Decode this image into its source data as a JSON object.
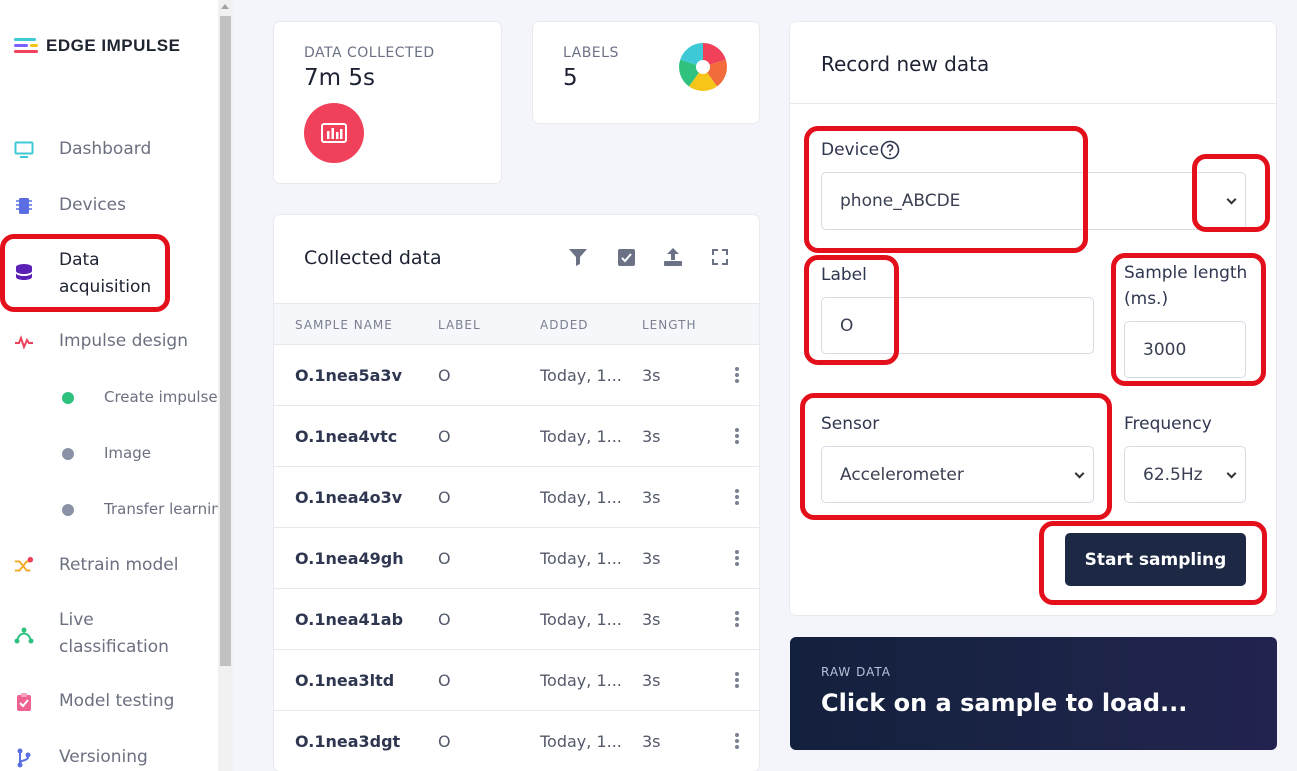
{
  "brand": {
    "name": "EDGE IMPULSE",
    "logo_colors": [
      "#3ec9d6",
      "#f5c518",
      "#f0405a",
      "#7b61ff"
    ]
  },
  "sidebar": {
    "items": [
      {
        "label": "Dashboard",
        "icon": "monitor-icon",
        "color": "#3ec9d6"
      },
      {
        "label": "Devices",
        "icon": "chip-icon",
        "color": "#5b6ee1"
      },
      {
        "label": "Data\nacquisition",
        "icon": "database-icon",
        "color": "#5b21b6"
      },
      {
        "label": "Impulse design",
        "icon": "pulse-icon",
        "color": "#f0405a"
      },
      {
        "label": "Retrain model",
        "icon": "shuffle-icon",
        "color": "#f5a623"
      },
      {
        "label": "Live\nclassification",
        "icon": "network-icon",
        "color": "#2ec27e"
      },
      {
        "label": "Model testing",
        "icon": "clipboard-check-icon",
        "color": "#f06292"
      },
      {
        "label": "Versioning",
        "icon": "branch-icon",
        "color": "#5b6ee1"
      }
    ],
    "sub_items": [
      {
        "label": "Create impulse",
        "dot_color": "#2ec27e"
      },
      {
        "label": "Image",
        "dot_color": "#8a92a6"
      },
      {
        "label": "Transfer learning",
        "dot_color": "#8a92a6"
      }
    ]
  },
  "stats": {
    "data_collected": {
      "label": "DATA COLLECTED",
      "value": "7m 5s",
      "icon": "bar-chart-icon",
      "color": "#f0405a"
    },
    "labels": {
      "label": "LABELS",
      "value": "5",
      "icon": "pie-chart-icon"
    }
  },
  "collected": {
    "title": "Collected data",
    "toolbar": [
      "filter-icon",
      "checkbox-icon",
      "upload-icon",
      "fullscreen-icon"
    ],
    "columns": [
      "SAMPLE NAME",
      "LABEL",
      "ADDED",
      "LENGTH"
    ],
    "rows": [
      {
        "name": "O.1nea5a3v",
        "label": "O",
        "added": "Today, 1...",
        "length": "3s"
      },
      {
        "name": "O.1nea4vtc",
        "label": "O",
        "added": "Today, 1...",
        "length": "3s"
      },
      {
        "name": "O.1nea4o3v",
        "label": "O",
        "added": "Today, 1...",
        "length": "3s"
      },
      {
        "name": "O.1nea49gh",
        "label": "O",
        "added": "Today, 1...",
        "length": "3s"
      },
      {
        "name": "O.1nea41ab",
        "label": "O",
        "added": "Today, 1...",
        "length": "3s"
      },
      {
        "name": "O.1nea3ltd",
        "label": "O",
        "added": "Today, 1...",
        "length": "3s"
      },
      {
        "name": "O.1nea3dgt",
        "label": "O",
        "added": "Today, 1...",
        "length": "3s"
      }
    ]
  },
  "record": {
    "title": "Record new data",
    "device_label": "Device",
    "device_value": "phone_ABCDE",
    "label_label": "Label",
    "label_value": "O",
    "sample_length_label": "Sample length\n(ms.)",
    "sample_length_value": "3000",
    "sensor_label": "Sensor",
    "sensor_value": "Accelerometer",
    "frequency_label": "Frequency",
    "frequency_value": "62.5Hz",
    "start_button": "Start sampling"
  },
  "raw": {
    "label": "RAW DATA",
    "text": "Click on a sample to load..."
  },
  "annotation_color": "#e3101c"
}
